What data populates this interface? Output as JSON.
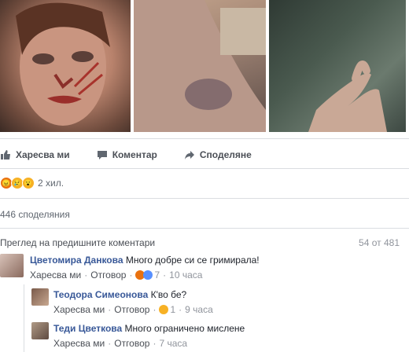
{
  "actions": {
    "like": "Харесва ми",
    "comment": "Коментар",
    "share": "Споделяне"
  },
  "reactions": {
    "icons": [
      "angry-emoji-icon",
      "sad-emoji-icon",
      "wow-emoji-icon"
    ],
    "count": "2 хил."
  },
  "shares": "446 споделяния",
  "previous": {
    "label": "Преглед на предишните коментари",
    "pager": "54 от 481"
  },
  "comments": [
    {
      "name": "Цветомира Данкова",
      "text": "Много добре си се гримирала!",
      "like": "Харесва ми",
      "reply": "Отговор",
      "reactions": "7",
      "time": "10 часа"
    },
    {
      "name": "Теодора Симеонова",
      "text": "К'во бе?",
      "like": "Харесва ми",
      "reply": "Отговор",
      "reactions": "1",
      "time": "9 часа"
    },
    {
      "name": "Теди Цветкова",
      "text": "Много ограничено мислене",
      "like": "Харесва ми",
      "reply": "Отговор",
      "time": "7 часа"
    }
  ],
  "colors": {
    "link": "#385898",
    "meta": "#90949c",
    "angry": "#e9710f",
    "emoji": "#f7b125",
    "like": "#5890ff"
  }
}
